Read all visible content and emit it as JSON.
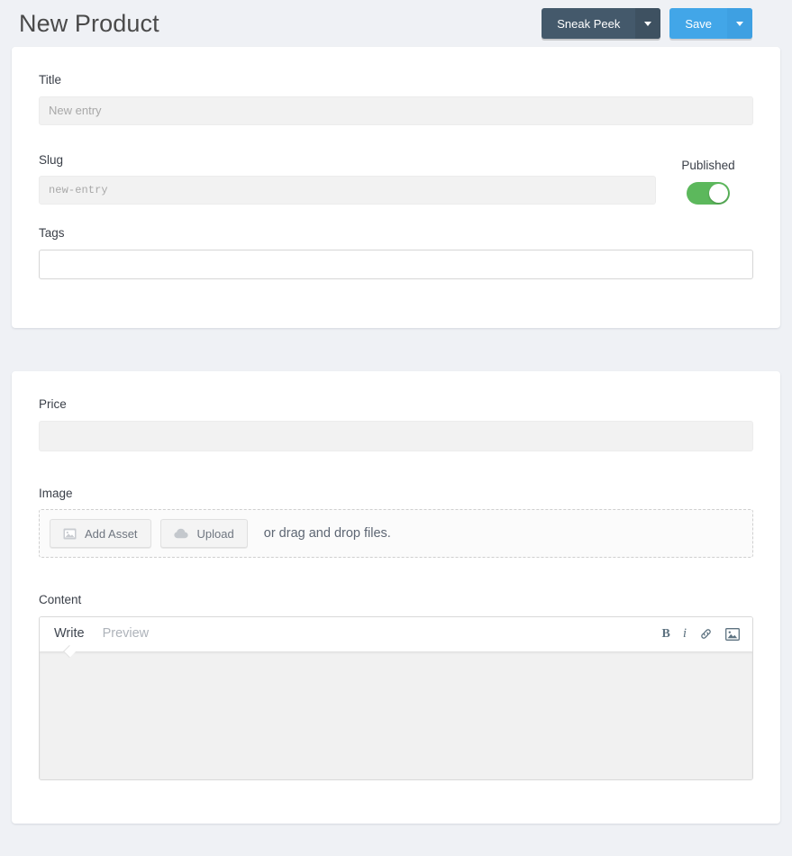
{
  "header": {
    "title": "New Product",
    "sneak_peek_label": "Sneak Peek",
    "sneak_peek_caret": "chevron-down-icon",
    "save_label": "Save",
    "save_caret": "chevron-down-icon",
    "sneak_peek_color": "#44596b",
    "save_color": "#42a6e8"
  },
  "card_main": {
    "title_field": {
      "label": "Title",
      "value": "",
      "placeholder": "New entry"
    },
    "slug_field": {
      "label": "Slug",
      "value": "",
      "placeholder": "new-entry"
    },
    "published": {
      "label": "Published",
      "state": "on",
      "color": "#5cb85c"
    },
    "tags_field": {
      "label": "Tags",
      "value": "",
      "placeholder": ""
    }
  },
  "card_details": {
    "price_field": {
      "label": "Price",
      "value": "",
      "placeholder": ""
    },
    "image_field": {
      "label": "Image",
      "add_asset_label": "Add Asset",
      "add_asset_icon": "image-icon",
      "upload_label": "Upload",
      "upload_icon": "cloud-upload-icon",
      "drag_text": "or drag and drop files."
    },
    "content_field": {
      "label": "Content",
      "tabs": [
        {
          "label": "Write",
          "active": true
        },
        {
          "label": "Preview",
          "active": false
        }
      ],
      "toolbar": [
        {
          "label": "B",
          "name": "bold-icon"
        },
        {
          "label": "i",
          "name": "italic-icon"
        },
        {
          "label": "",
          "name": "link-icon"
        },
        {
          "label": "",
          "name": "image-icon"
        }
      ],
      "body_value": ""
    }
  }
}
